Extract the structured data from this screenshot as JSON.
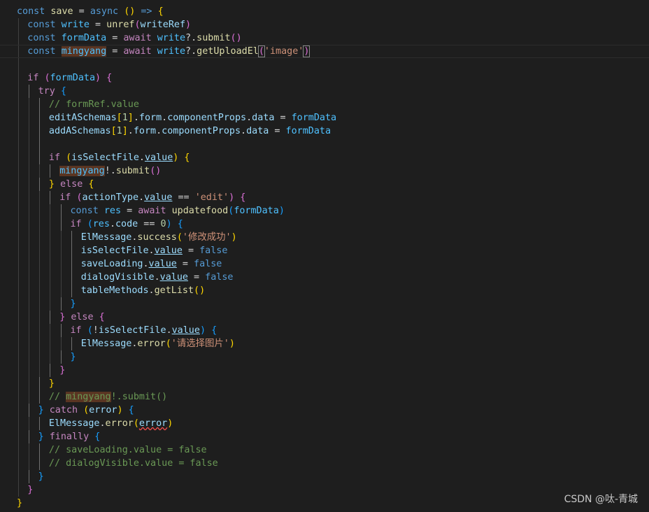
{
  "editor": {
    "lines": [
      [
        {
          "t": "const",
          "c": "kw"
        },
        {
          "t": " "
        },
        {
          "t": "save",
          "c": "fn"
        },
        {
          "t": " = "
        },
        {
          "t": "async",
          "c": "kw"
        },
        {
          "t": " "
        },
        {
          "t": "()",
          "c": "b1"
        },
        {
          "t": " "
        },
        {
          "t": "=>",
          "c": "kw"
        },
        {
          "t": " "
        },
        {
          "t": "{",
          "c": "b1"
        }
      ],
      [
        {
          "t": "const",
          "c": "kw"
        },
        {
          "t": " "
        },
        {
          "t": "write",
          "c": "cst"
        },
        {
          "t": " = "
        },
        {
          "t": "unref",
          "c": "fn"
        },
        {
          "t": "(",
          "c": "b2"
        },
        {
          "t": "writeRef",
          "c": "var"
        },
        {
          "t": ")",
          "c": "b2"
        }
      ],
      [
        {
          "t": "const",
          "c": "kw"
        },
        {
          "t": " "
        },
        {
          "t": "formData",
          "c": "cst"
        },
        {
          "t": " = "
        },
        {
          "t": "await",
          "c": "ctl"
        },
        {
          "t": " "
        },
        {
          "t": "write",
          "c": "cst"
        },
        {
          "t": "?."
        },
        {
          "t": "submit",
          "c": "fn"
        },
        {
          "t": "()",
          "c": "b2"
        }
      ],
      [
        {
          "t": "const",
          "c": "kw"
        },
        {
          "t": " "
        },
        {
          "t": "mingyang",
          "c": "cst hlw"
        },
        {
          "t": " = "
        },
        {
          "t": "await",
          "c": "ctl"
        },
        {
          "t": " "
        },
        {
          "t": "write",
          "c": "cst"
        },
        {
          "t": "?."
        },
        {
          "t": "getUploadEl",
          "c": "fn"
        },
        {
          "t": "(",
          "c": "b2 bm"
        },
        {
          "t": "'image'",
          "c": "str"
        },
        {
          "t": ")",
          "c": "b2 bm"
        }
      ],
      [],
      [
        {
          "t": "if",
          "c": "ctl"
        },
        {
          "t": " "
        },
        {
          "t": "(",
          "c": "b2"
        },
        {
          "t": "formData",
          "c": "cst"
        },
        {
          "t": ")",
          "c": "b2"
        },
        {
          "t": " "
        },
        {
          "t": "{",
          "c": "b2"
        }
      ],
      [
        {
          "t": "try",
          "c": "ctl"
        },
        {
          "t": " "
        },
        {
          "t": "{",
          "c": "b3"
        }
      ],
      [
        {
          "t": "// formRef.value",
          "c": "cmt"
        }
      ],
      [
        {
          "t": "editASchemas",
          "c": "var"
        },
        {
          "t": "[",
          "c": "b1"
        },
        {
          "t": "1",
          "c": "num"
        },
        {
          "t": "]",
          "c": "b1"
        },
        {
          "t": "."
        },
        {
          "t": "form",
          "c": "var"
        },
        {
          "t": "."
        },
        {
          "t": "componentProps",
          "c": "var"
        },
        {
          "t": "."
        },
        {
          "t": "data",
          "c": "var"
        },
        {
          "t": " = "
        },
        {
          "t": "formData",
          "c": "cst"
        }
      ],
      [
        {
          "t": "addASchemas",
          "c": "var"
        },
        {
          "t": "[",
          "c": "b1"
        },
        {
          "t": "1",
          "c": "num"
        },
        {
          "t": "]",
          "c": "b1"
        },
        {
          "t": "."
        },
        {
          "t": "form",
          "c": "var"
        },
        {
          "t": "."
        },
        {
          "t": "componentProps",
          "c": "var"
        },
        {
          "t": "."
        },
        {
          "t": "data",
          "c": "var"
        },
        {
          "t": " = "
        },
        {
          "t": "formData",
          "c": "cst"
        }
      ],
      [],
      [
        {
          "t": "if",
          "c": "ctl"
        },
        {
          "t": " "
        },
        {
          "t": "(",
          "c": "b1"
        },
        {
          "t": "isSelectFile",
          "c": "var"
        },
        {
          "t": "."
        },
        {
          "t": "value",
          "c": "var und"
        },
        {
          "t": ")",
          "c": "b1"
        },
        {
          "t": " "
        },
        {
          "t": "{",
          "c": "b1"
        }
      ],
      [
        {
          "t": "mingyang",
          "c": "cst hlw"
        },
        {
          "t": "!."
        },
        {
          "t": "submit",
          "c": "fn"
        },
        {
          "t": "()",
          "c": "b2"
        }
      ],
      [
        {
          "t": "}",
          "c": "b1"
        },
        {
          "t": " "
        },
        {
          "t": "else",
          "c": "ctl"
        },
        {
          "t": " "
        },
        {
          "t": "{",
          "c": "b1"
        }
      ],
      [
        {
          "t": "if",
          "c": "ctl"
        },
        {
          "t": " "
        },
        {
          "t": "(",
          "c": "b2"
        },
        {
          "t": "actionType",
          "c": "var"
        },
        {
          "t": "."
        },
        {
          "t": "value",
          "c": "var und"
        },
        {
          "t": " == "
        },
        {
          "t": "'edit'",
          "c": "str"
        },
        {
          "t": ")",
          "c": "b2"
        },
        {
          "t": " "
        },
        {
          "t": "{",
          "c": "b2"
        }
      ],
      [
        {
          "t": "const",
          "c": "kw"
        },
        {
          "t": " "
        },
        {
          "t": "res",
          "c": "cst"
        },
        {
          "t": " = "
        },
        {
          "t": "await",
          "c": "ctl"
        },
        {
          "t": " "
        },
        {
          "t": "updatefood",
          "c": "fn"
        },
        {
          "t": "(",
          "c": "b3"
        },
        {
          "t": "formData",
          "c": "cst"
        },
        {
          "t": ")",
          "c": "b3"
        }
      ],
      [
        {
          "t": "if",
          "c": "ctl"
        },
        {
          "t": " "
        },
        {
          "t": "(",
          "c": "b3"
        },
        {
          "t": "res",
          "c": "cst"
        },
        {
          "t": "."
        },
        {
          "t": "code",
          "c": "var"
        },
        {
          "t": " == "
        },
        {
          "t": "0",
          "c": "num"
        },
        {
          "t": ")",
          "c": "b3"
        },
        {
          "t": " "
        },
        {
          "t": "{",
          "c": "b3"
        }
      ],
      [
        {
          "t": "ElMessage",
          "c": "var"
        },
        {
          "t": "."
        },
        {
          "t": "success",
          "c": "fn"
        },
        {
          "t": "(",
          "c": "b1"
        },
        {
          "t": "'修改成功'",
          "c": "str"
        },
        {
          "t": ")",
          "c": "b1"
        }
      ],
      [
        {
          "t": "isSelectFile",
          "c": "var"
        },
        {
          "t": "."
        },
        {
          "t": "value",
          "c": "var und"
        },
        {
          "t": " = "
        },
        {
          "t": "false",
          "c": "kw"
        }
      ],
      [
        {
          "t": "saveLoading",
          "c": "var"
        },
        {
          "t": "."
        },
        {
          "t": "value",
          "c": "var und"
        },
        {
          "t": " = "
        },
        {
          "t": "false",
          "c": "kw"
        }
      ],
      [
        {
          "t": "dialogVisible",
          "c": "var"
        },
        {
          "t": "."
        },
        {
          "t": "value",
          "c": "var und"
        },
        {
          "t": " = "
        },
        {
          "t": "false",
          "c": "kw"
        }
      ],
      [
        {
          "t": "tableMethods",
          "c": "var"
        },
        {
          "t": "."
        },
        {
          "t": "getList",
          "c": "fn"
        },
        {
          "t": "()",
          "c": "b1"
        }
      ],
      [
        {
          "t": "}",
          "c": "b3"
        }
      ],
      [
        {
          "t": "}",
          "c": "b2"
        },
        {
          "t": " "
        },
        {
          "t": "else",
          "c": "ctl"
        },
        {
          "t": " "
        },
        {
          "t": "{",
          "c": "b2"
        }
      ],
      [
        {
          "t": "if",
          "c": "ctl"
        },
        {
          "t": " "
        },
        {
          "t": "(",
          "c": "b3"
        },
        {
          "t": "!"
        },
        {
          "t": "isSelectFile",
          "c": "var"
        },
        {
          "t": "."
        },
        {
          "t": "value",
          "c": "var und"
        },
        {
          "t": ")",
          "c": "b3"
        },
        {
          "t": " "
        },
        {
          "t": "{",
          "c": "b3"
        }
      ],
      [
        {
          "t": "ElMessage",
          "c": "var"
        },
        {
          "t": "."
        },
        {
          "t": "error",
          "c": "fn"
        },
        {
          "t": "(",
          "c": "b1"
        },
        {
          "t": "'请选择图片'",
          "c": "str"
        },
        {
          "t": ")",
          "c": "b1"
        }
      ],
      [
        {
          "t": "}",
          "c": "b3"
        }
      ],
      [
        {
          "t": "}",
          "c": "b2"
        }
      ],
      [
        {
          "t": "}",
          "c": "b1"
        }
      ],
      [
        {
          "t": "// ",
          "c": "cmt"
        },
        {
          "t": "mingyang",
          "c": "cmt hlw"
        },
        {
          "t": "!.submit()",
          "c": "cmt"
        }
      ],
      [
        {
          "t": "}",
          "c": "b3"
        },
        {
          "t": " "
        },
        {
          "t": "catch",
          "c": "ctl"
        },
        {
          "t": " "
        },
        {
          "t": "(",
          "c": "b1"
        },
        {
          "t": "error",
          "c": "var"
        },
        {
          "t": ")",
          "c": "b1"
        },
        {
          "t": " "
        },
        {
          "t": "{",
          "c": "b3"
        }
      ],
      [
        {
          "t": "ElMessage",
          "c": "var"
        },
        {
          "t": "."
        },
        {
          "t": "error",
          "c": "fn"
        },
        {
          "t": "(",
          "c": "b1"
        },
        {
          "t": "error",
          "c": "var squig"
        },
        {
          "t": ")",
          "c": "b1"
        }
      ],
      [
        {
          "t": "}",
          "c": "b3"
        },
        {
          "t": " "
        },
        {
          "t": "finally",
          "c": "ctl"
        },
        {
          "t": " "
        },
        {
          "t": "{",
          "c": "b3"
        }
      ],
      [
        {
          "t": "// saveLoading.value = false",
          "c": "cmt"
        }
      ],
      [
        {
          "t": "// dialogVisible.value = false",
          "c": "cmt"
        }
      ],
      [
        {
          "t": "}",
          "c": "b3"
        }
      ],
      [
        {
          "t": "}",
          "c": "b2"
        }
      ],
      [
        {
          "t": "}",
          "c": "b1"
        }
      ]
    ]
  },
  "watermark": "CSDN @呔-青城"
}
